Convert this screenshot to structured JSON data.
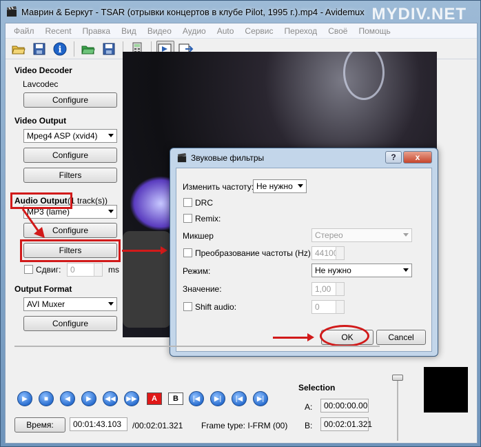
{
  "window": {
    "title": "Маврин & Беркут - TSAR (отрывки концертов в клубе Pilot, 1995 г.).mp4 - Avidemux",
    "watermark": "MYDIV.NET"
  },
  "menu": [
    "Файл",
    "Recent",
    "Правка",
    "Вид",
    "Видео",
    "Аудио",
    "Auto",
    "Сервис",
    "Переход",
    "Своё",
    "Помощь"
  ],
  "toolbar_icons": [
    "open-folder-icon",
    "save-icon",
    "info-icon",
    "open-video-icon",
    "save-video-icon",
    "calculator-icon",
    "play-filtered-icon",
    "output-icon"
  ],
  "left": {
    "video_decoder": {
      "heading": "Video Decoder",
      "codec": "Lavcodec",
      "configure": "Configure"
    },
    "video_output": {
      "heading": "Video Output",
      "codec": "Mpeg4 ASP (xvid4)",
      "configure": "Configure",
      "filters": "Filters"
    },
    "audio_output": {
      "heading": "Audio Output",
      "tracks": "(1 track(s))",
      "codec": "MP3 (lame)",
      "configure": "Configure",
      "filters": "Filters",
      "shift_label": "Сдвиг:",
      "shift_value": "0",
      "shift_unit": "ms"
    },
    "output_format": {
      "heading": "Output Format",
      "muxer": "AVI Muxer",
      "configure": "Configure"
    }
  },
  "dialog": {
    "title": "Звуковые фильтры",
    "help": "?",
    "close": "x",
    "change_rate_label": "Изменить частоту:",
    "change_rate_value": "Не нужно",
    "drc": "DRC",
    "remix": "Remix:",
    "mixer_label": "Микшер",
    "mixer_value": "Стерео",
    "resample_label": "Преобразование частоты (Hz):",
    "resample_value": "44100",
    "mode_label": "Режим:",
    "mode_value": "Не нужно",
    "value_label": "Значение:",
    "value_value": "1,00",
    "shift_label": "Shift audio:",
    "shift_value": "0",
    "ok": "OK",
    "cancel": "Cancel"
  },
  "bottom": {
    "selection_label": "Selection",
    "a_label": "A:",
    "a_value": "00:00:00.00",
    "b_label": "B:",
    "b_value": "00:02:01.321",
    "time_button": "Время:",
    "current_time": "00:01:43.103",
    "total_time": "/00:02:01.321",
    "frame_type": "Frame type:  I-FRM (00)",
    "marker_a": "A",
    "marker_b": "B"
  }
}
